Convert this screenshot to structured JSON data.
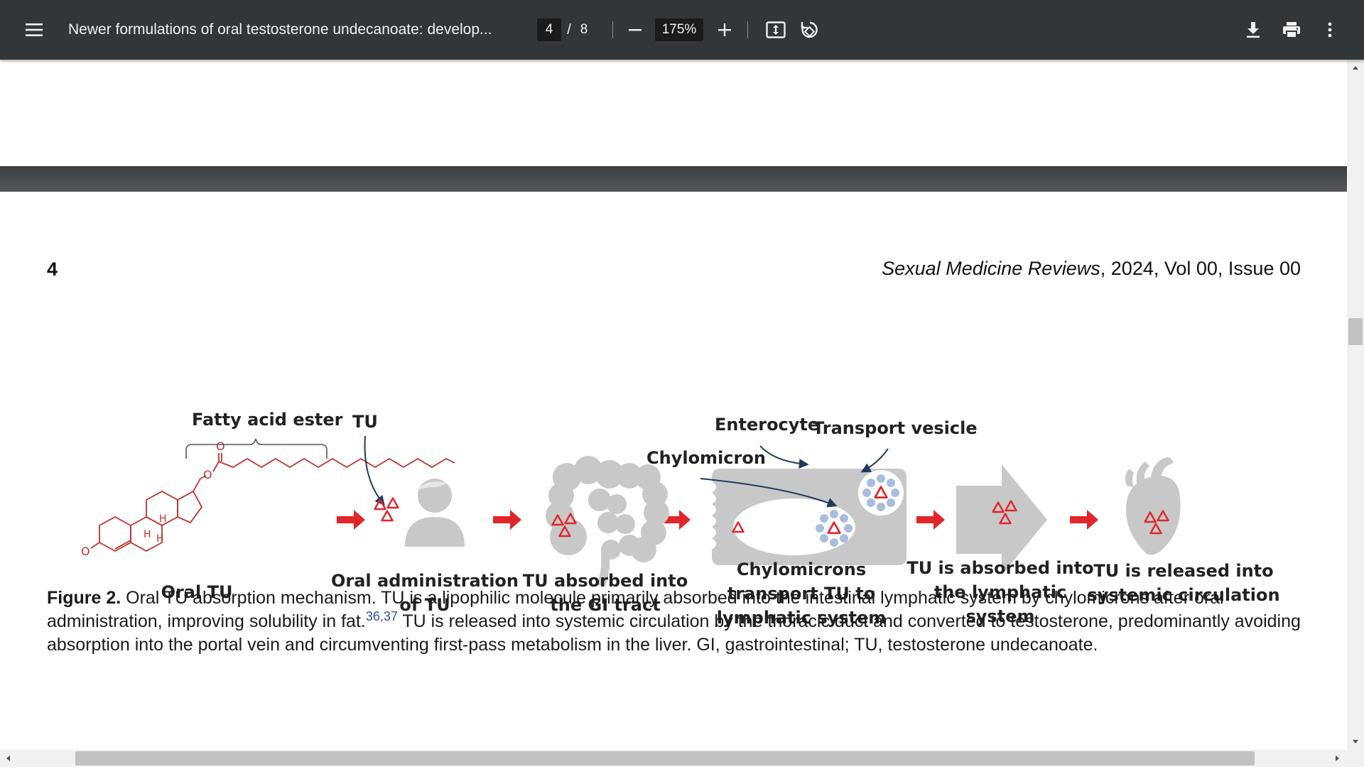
{
  "toolbar": {
    "title": "Newer formulations of oral testosterone undecanoate: develop...",
    "current_page": "4",
    "page_separator": "/",
    "total_pages": "8",
    "zoom": "175%",
    "icons": [
      "menu-icon",
      "minus-icon",
      "plus-icon",
      "fit-page-icon",
      "rotate-icon",
      "download-icon",
      "print-icon",
      "more-vert-icon"
    ]
  },
  "page": {
    "number": "4",
    "journal_name": "Sexual Medicine Reviews",
    "journal_rest": ", 2024, Vol 00, Issue 00"
  },
  "figure": {
    "labels": {
      "fatty_acid_ester": "Fatty acid ester",
      "tu": "TU",
      "enterocyte": "Enterocyte",
      "transport_vesicle": "Transport vesicle",
      "chylomicron": "Chylomicron",
      "oral_tu": "Oral TU",
      "oral_admin_1": "Oral administration",
      "oral_admin_2": "of TU",
      "gi_1": "TU absorbed into",
      "gi_2": "the GI tract",
      "chylo_1": "Chylomicrons",
      "chylo_2": "transport TU to",
      "chylo_3": "lymphatic system",
      "lymph_1": "TU is absorbed into",
      "lymph_2": "the lymphatic",
      "lymph_3": "system",
      "sys_1": "TU is released into",
      "sys_2": "systemic circulation",
      "mol_o1": "O",
      "mol_o2": "O",
      "mol_o3": "O",
      "mol_h1": "H",
      "mol_h2": "H",
      "mol_h3": "H"
    },
    "colors": {
      "arrow_red": "#e0262b",
      "molecule_red": "#c0302e",
      "organ_gray": "#c8c8c8",
      "vesicle_blue": "#a9bde0"
    }
  },
  "caption": {
    "label": "Figure 2.",
    "text1": " Oral TU absorption mechanism. TU is a lipophilic molecule primarily absorbed into the intestinal lymphatic system by chylomicrons after oral administration, improving solubility in fat.",
    "refs": "36,37",
    "text2": " TU is released into systemic circulation by the thoracic duct and converted to testosterone, predominantly avoiding absorption into the portal vein and circumventing first-pass metabolism in the liver. GI, gastrointestinal; TU, testosterone undecanoate."
  }
}
